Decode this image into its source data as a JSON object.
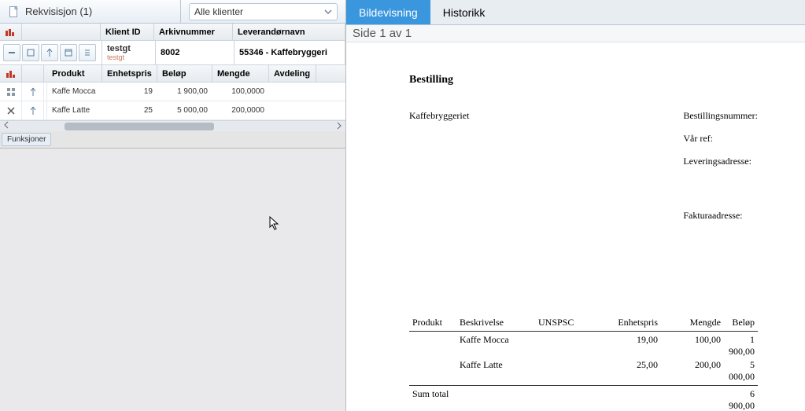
{
  "header": {
    "doc_title": "Rekvisisjon (1)",
    "filter": "Alle klienter"
  },
  "upper_grid": {
    "headers": {
      "klient_id": "Klient ID",
      "arkiv": "Arkivnummer",
      "lev": "Leverandørnavn"
    },
    "row": {
      "klient_id": "testgt",
      "klient_sub": "testgt",
      "arkiv": "8002",
      "lev": "55346 - Kaffebryggeri"
    }
  },
  "lower_grid": {
    "headers": {
      "produkt": "Produkt",
      "ep": "Enhetspris",
      "belop": "Beløp",
      "mengde": "Mengde",
      "avd": "Avdeling"
    },
    "rows": [
      {
        "produkt": "Kaffe Mocca",
        "ep": "19",
        "belop": "1 900,00",
        "mengde": "100,0000"
      },
      {
        "produkt": "Kaffe Latte",
        "ep": "25",
        "belop": "5 000,00",
        "mengde": "200,0000"
      }
    ]
  },
  "funk_label": "Funksjoner",
  "right": {
    "tabs": {
      "image": "Bildevisning",
      "history": "Historikk"
    },
    "page": "Side 1 av 1",
    "doc": {
      "title": "Bestilling",
      "supplier": "Kaffebryggeriet",
      "labels": {
        "bestnr": "Bestillingsnummer:",
        "varref": "Vår ref:",
        "levadr": "Leveringsadresse:",
        "faktadr": "Fakturaadresse:"
      },
      "table": {
        "headers": {
          "produkt": "Produkt",
          "besk": "Beskrivelse",
          "unspsc": "UNSPSC",
          "ep": "Enhetspris",
          "mg": "Mengde",
          "bl": "Beløp"
        },
        "rows": [
          {
            "besk": "Kaffe Mocca",
            "ep": "19,00",
            "mg": "100,00",
            "bl": "1 900,00"
          },
          {
            "besk": "Kaffe Latte",
            "ep": "25,00",
            "mg": "200,00",
            "bl": "5 000,00"
          }
        ],
        "sum_label": "Sum total",
        "sum_val": "6 900,00"
      }
    }
  }
}
